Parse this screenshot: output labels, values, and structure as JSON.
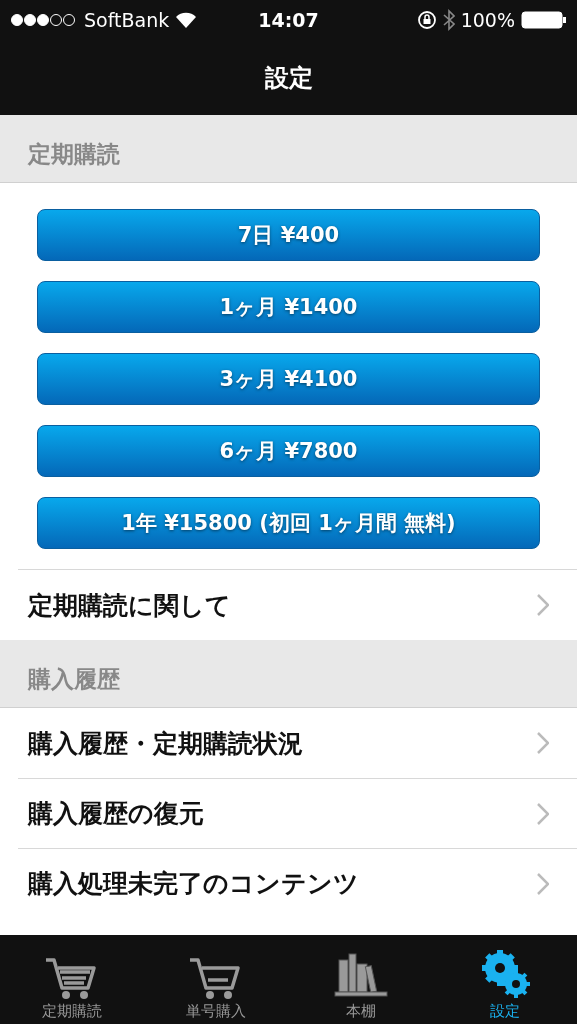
{
  "status_bar": {
    "carrier": "SoftBank",
    "time": "14:07",
    "battery": "100%"
  },
  "nav_bar": {
    "title": "設定"
  },
  "sections": [
    {
      "header": "定期購読",
      "buttons": [
        "7日 ¥400",
        "1ヶ月 ¥1400",
        "3ヶ月 ¥4100",
        "6ヶ月 ¥7800",
        "1年 ¥15800 (初回 1ヶ月間 無料)"
      ],
      "rows": [
        "定期購読に関して"
      ]
    },
    {
      "header": "購入履歴",
      "rows": [
        "購入履歴・定期購読状況",
        "購入履歴の復元",
        "購入処理未完了のコンテンツ"
      ]
    }
  ],
  "tab_bar": [
    {
      "label": "定期購読",
      "kind": "cart-lines",
      "selected": false
    },
    {
      "label": "単号購入",
      "kind": "cart",
      "selected": false
    },
    {
      "label": "本棚",
      "kind": "books",
      "selected": false
    },
    {
      "label": "設定",
      "kind": "gears",
      "selected": true
    }
  ]
}
